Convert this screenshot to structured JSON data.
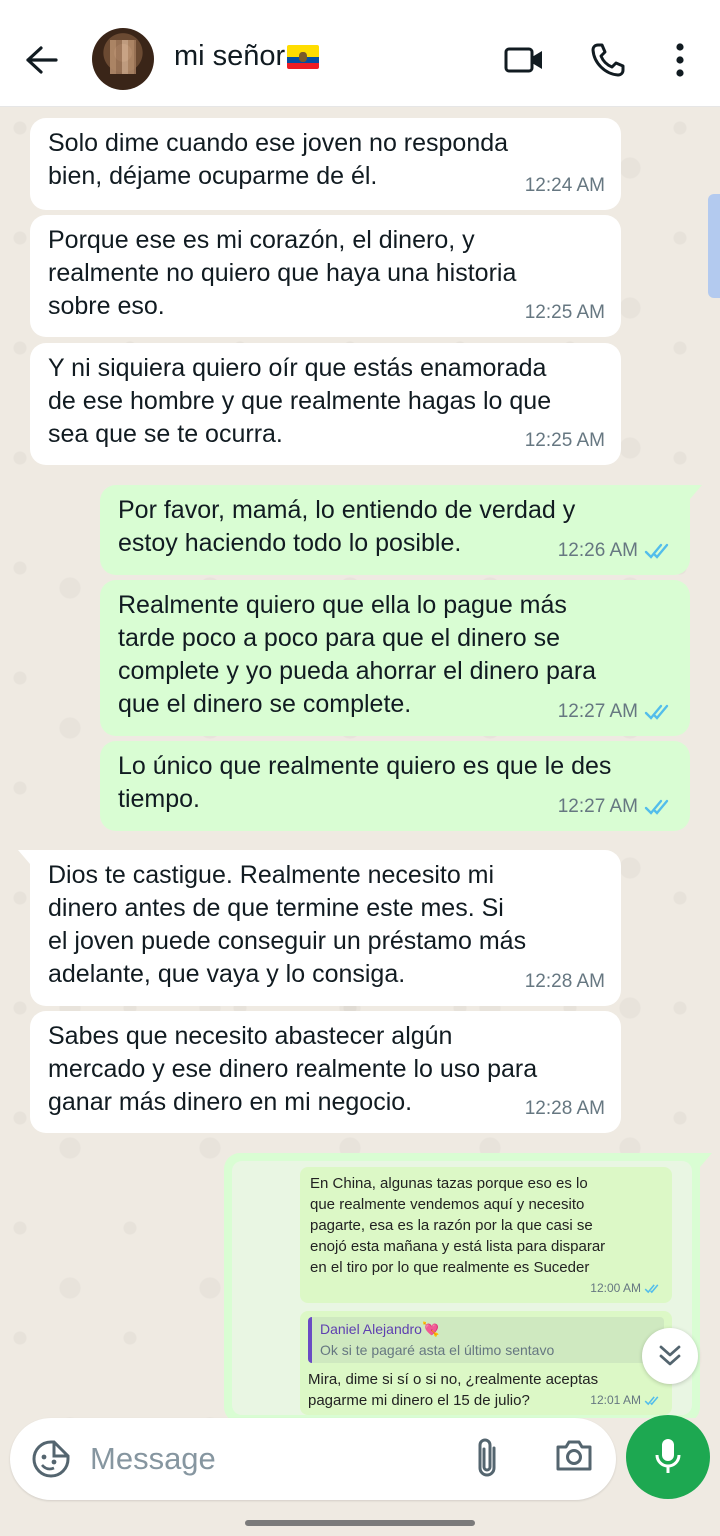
{
  "header": {
    "contact_name": "mi señor",
    "flag": "ecuador-flag",
    "icons": [
      "back-arrow-icon",
      "video-call-icon",
      "phone-icon",
      "more-vert-icon"
    ]
  },
  "messages": [
    {
      "dir": "in",
      "text": "Solo dime cuando ese joven no responda\nbien, déjame ocuparme de él.",
      "time": "12:24 AM"
    },
    {
      "dir": "in",
      "text": "Porque ese es mi corazón, el dinero, y\nrealmente no quiero que haya una historia\nsobre eso.",
      "time": "12:25 AM"
    },
    {
      "dir": "in",
      "text": "Y ni siquiera quiero oír que estás enamorada\nde ese hombre y que realmente hagas lo que\nsea que se te ocurra.",
      "time": "12:25 AM"
    },
    {
      "dir": "out",
      "text": "Por favor, mamá, lo entiendo de verdad y\nestoy haciendo todo lo posible.",
      "time": "12:26 AM"
    },
    {
      "dir": "out",
      "text": "Realmente quiero que ella lo pague más\ntarde poco a poco para que el dinero se\ncomplete y yo pueda ahorrar el dinero para\nque el dinero se complete.",
      "time": "12:27 AM"
    },
    {
      "dir": "out",
      "text": "Lo único que realmente quiero es que le des\ntiempo.",
      "time": "12:27 AM"
    },
    {
      "dir": "in",
      "text": "Dios te castigue. Realmente necesito mi\ndinero antes de que termine este mes. Si\nel joven puede conseguir un préstamo más\nadelante, que vaya y lo consiga.",
      "time": "12:28 AM"
    },
    {
      "dir": "in",
      "text": "Sabes que necesito abastecer algún\nmercado y ese dinero realmente lo uso para\nganar más dinero en mi negocio.",
      "time": "12:28 AM"
    }
  ],
  "image_message": {
    "bubble1_text": "En China, algunas tazas porque eso es lo\nque realmente vendemos aquí y necesito\npagarte, esa es la razón por la que casi se\nenojó esta mañana y está lista para disparar\nen el tiro por lo que realmente es Suceder",
    "bubble1_time": "12:00 AM",
    "quote_name": "Daniel Alejandro💘",
    "quote_text": "Ok si te pagaré asta el último sentavo",
    "bubble2_text": "Mira, dime si sí o si no, ¿realmente aceptas\npagarme mi dinero el 15 de julio?",
    "bubble2_time": "12:01 AM"
  },
  "input": {
    "placeholder": "Message"
  },
  "colors": {
    "incoming": "#ffffff",
    "outgoing": "#d9fdd3",
    "read_ticks": "#53bdeb",
    "mic_button": "#1da851"
  }
}
